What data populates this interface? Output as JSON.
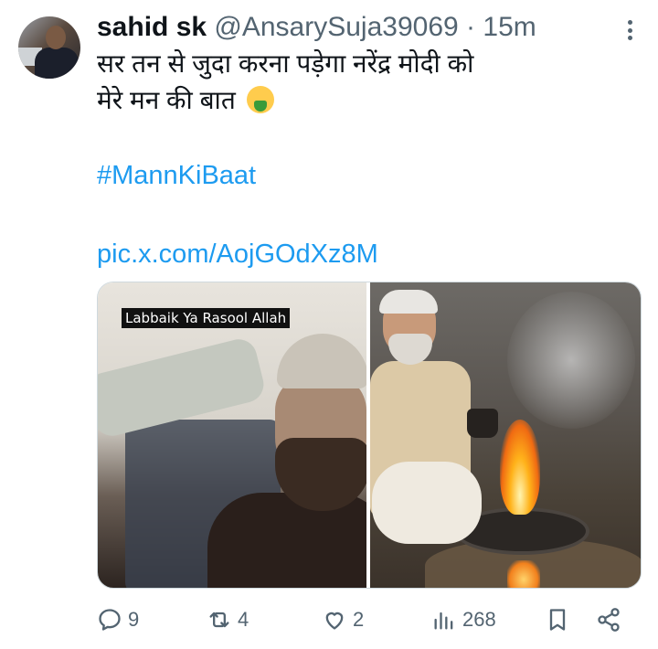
{
  "tweet": {
    "author_name": "sahid sk",
    "handle": "@AnsarySuja39069",
    "separator": "·",
    "time": "15m",
    "text_line1": "सर तन से जुदा करना पड़ेगा नरेंद्र मोदी को",
    "text_line2": "मेरे मन की बात",
    "hashtag": "#MannKiBaat",
    "link": "pic.x.com/AojGOdXz8M",
    "media": {
      "left_image_caption": "Labbaik Ya Rasool Allah"
    },
    "stats": {
      "replies": "9",
      "retweets": "4",
      "likes": "2",
      "views": "268"
    }
  },
  "colors": {
    "text": "#0f1419",
    "secondary": "#536471",
    "link": "#1d9bf0"
  },
  "icons": {
    "more": "more-vertical-icon",
    "reply": "reply-icon",
    "retweet": "retweet-icon",
    "like": "heart-icon",
    "views": "views-chart-icon",
    "bookmark": "bookmark-icon",
    "share": "share-icon",
    "emoji": "nauseated-face-emoji"
  }
}
